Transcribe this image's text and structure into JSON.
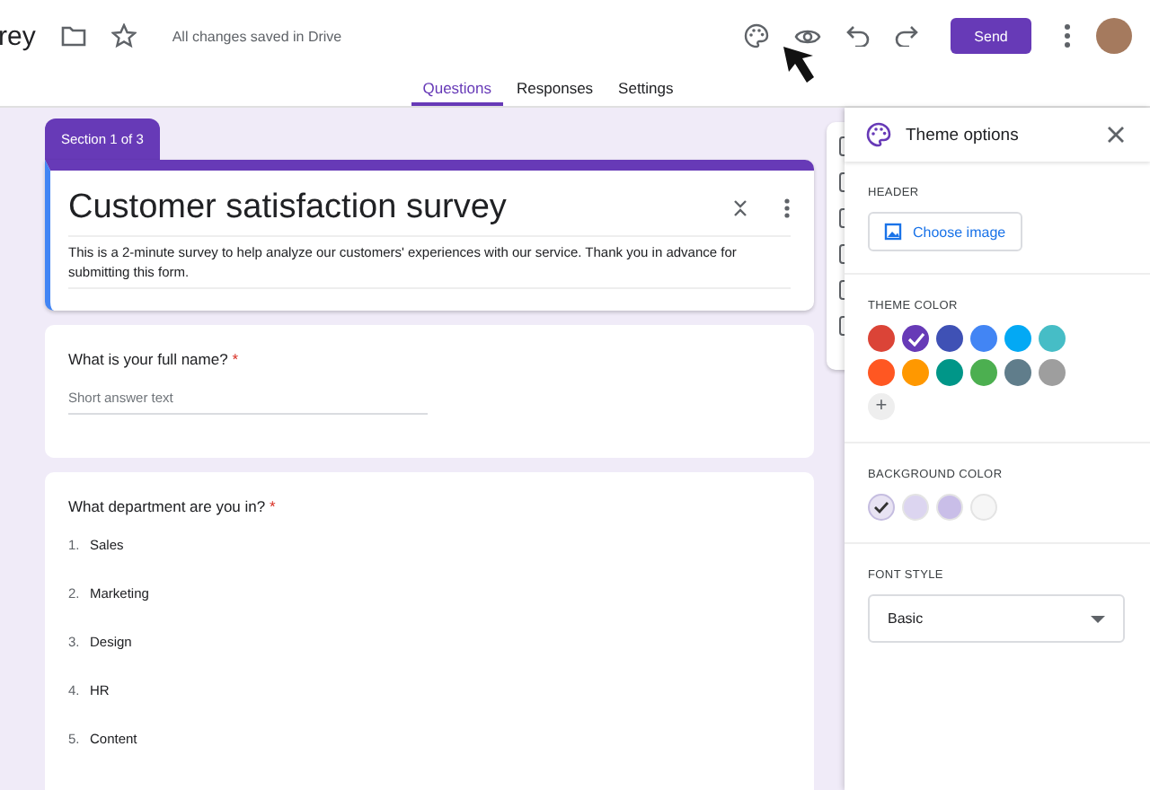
{
  "header": {
    "title_fragment": "rey",
    "save_status": "All changes saved in Drive",
    "send_button": "Send"
  },
  "tabs": [
    {
      "label": "Questions",
      "selected": true
    },
    {
      "label": "Responses",
      "selected": false
    },
    {
      "label": "Settings",
      "selected": false
    }
  ],
  "form": {
    "section_label": "Section 1 of 3",
    "title": "Customer satisfaction survey",
    "description": "This is a 2-minute survey to help analyze our customers' experiences with our service. Thank you in advance for submitting this form.",
    "questions": [
      {
        "kind": "short_answer",
        "title": "What is your full name?",
        "required_mark": "*",
        "placeholder": "Short answer text"
      },
      {
        "kind": "list",
        "title": "What department are you in?",
        "required_mark": "*",
        "options": [
          {
            "number": "1.",
            "label": "Sales"
          },
          {
            "number": "2.",
            "label": "Marketing"
          },
          {
            "number": "3.",
            "label": "Design"
          },
          {
            "number": "4.",
            "label": "HR"
          },
          {
            "number": "5.",
            "label": "Content"
          }
        ]
      }
    ]
  },
  "theme_panel": {
    "title": "Theme options",
    "header_label": "HEADER",
    "choose_image": "Choose image",
    "theme_color_label": "THEME COLOR",
    "theme_colors": [
      {
        "color": "#db4437",
        "selected": false
      },
      {
        "color": "#673ab7",
        "selected": true
      },
      {
        "color": "#3f51b5",
        "selected": false
      },
      {
        "color": "#4285f4",
        "selected": false
      },
      {
        "color": "#03a9f4",
        "selected": false
      },
      {
        "color": "#46bdc6",
        "selected": false
      },
      {
        "color": "#ff5722",
        "selected": false
      },
      {
        "color": "#ff9800",
        "selected": false
      },
      {
        "color": "#009688",
        "selected": false
      },
      {
        "color": "#4caf50",
        "selected": false
      },
      {
        "color": "#607d8b",
        "selected": false
      },
      {
        "color": "#9e9e9e",
        "selected": false
      }
    ],
    "add_color": "+",
    "background_color_label": "BACKGROUND COLOR",
    "background_colors": [
      {
        "color": "#e8e3f3",
        "selected": true
      },
      {
        "color": "#dcd5f0",
        "selected": false
      },
      {
        "color": "#c9bee8",
        "selected": false
      },
      {
        "color": "#f6f6f6",
        "selected": false
      }
    ],
    "font_style_label": "FONT STYLE",
    "font_style": "Basic"
  }
}
